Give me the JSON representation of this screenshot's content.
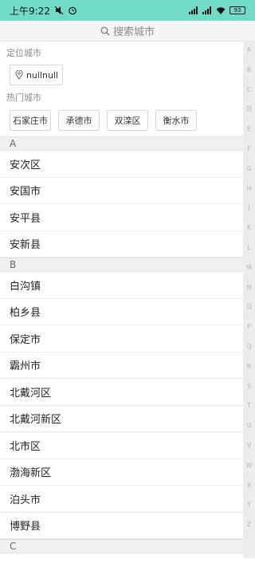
{
  "status_bar": {
    "time": "上午9:22",
    "network_text": "4G 4G",
    "battery": "93"
  },
  "search": {
    "placeholder": "搜索城市"
  },
  "location": {
    "section_label": "定位城市",
    "city": "nullnull"
  },
  "hot": {
    "section_label": "热门城市",
    "cities": [
      "石家庄市",
      "承德市",
      "双滦区",
      "衡水市"
    ]
  },
  "groups": [
    {
      "letter": "A",
      "cities": [
        "安次区",
        "安国市",
        "安平县",
        "安新县"
      ]
    },
    {
      "letter": "B",
      "cities": [
        "白沟镇",
        "柏乡县",
        "保定市",
        "霸州市",
        "北戴河区",
        "北戴河新区",
        "北市区",
        "渤海新区",
        "泊头市",
        "博野县"
      ]
    },
    {
      "letter": "C",
      "cities": []
    }
  ],
  "index_letters": [
    "A",
    "B",
    "C",
    "D",
    "E",
    "F",
    "G",
    "H",
    "J",
    "K",
    "L",
    "M",
    "N",
    "O",
    "P",
    "Q",
    "R",
    "S",
    "T",
    "U",
    "V",
    "W",
    "X",
    "Y",
    "Z"
  ],
  "colors": {
    "status_bar_bg": "#6fdcc7",
    "group_header_bg": "#f0f0f0",
    "index_bar_bg": "#ececec"
  }
}
